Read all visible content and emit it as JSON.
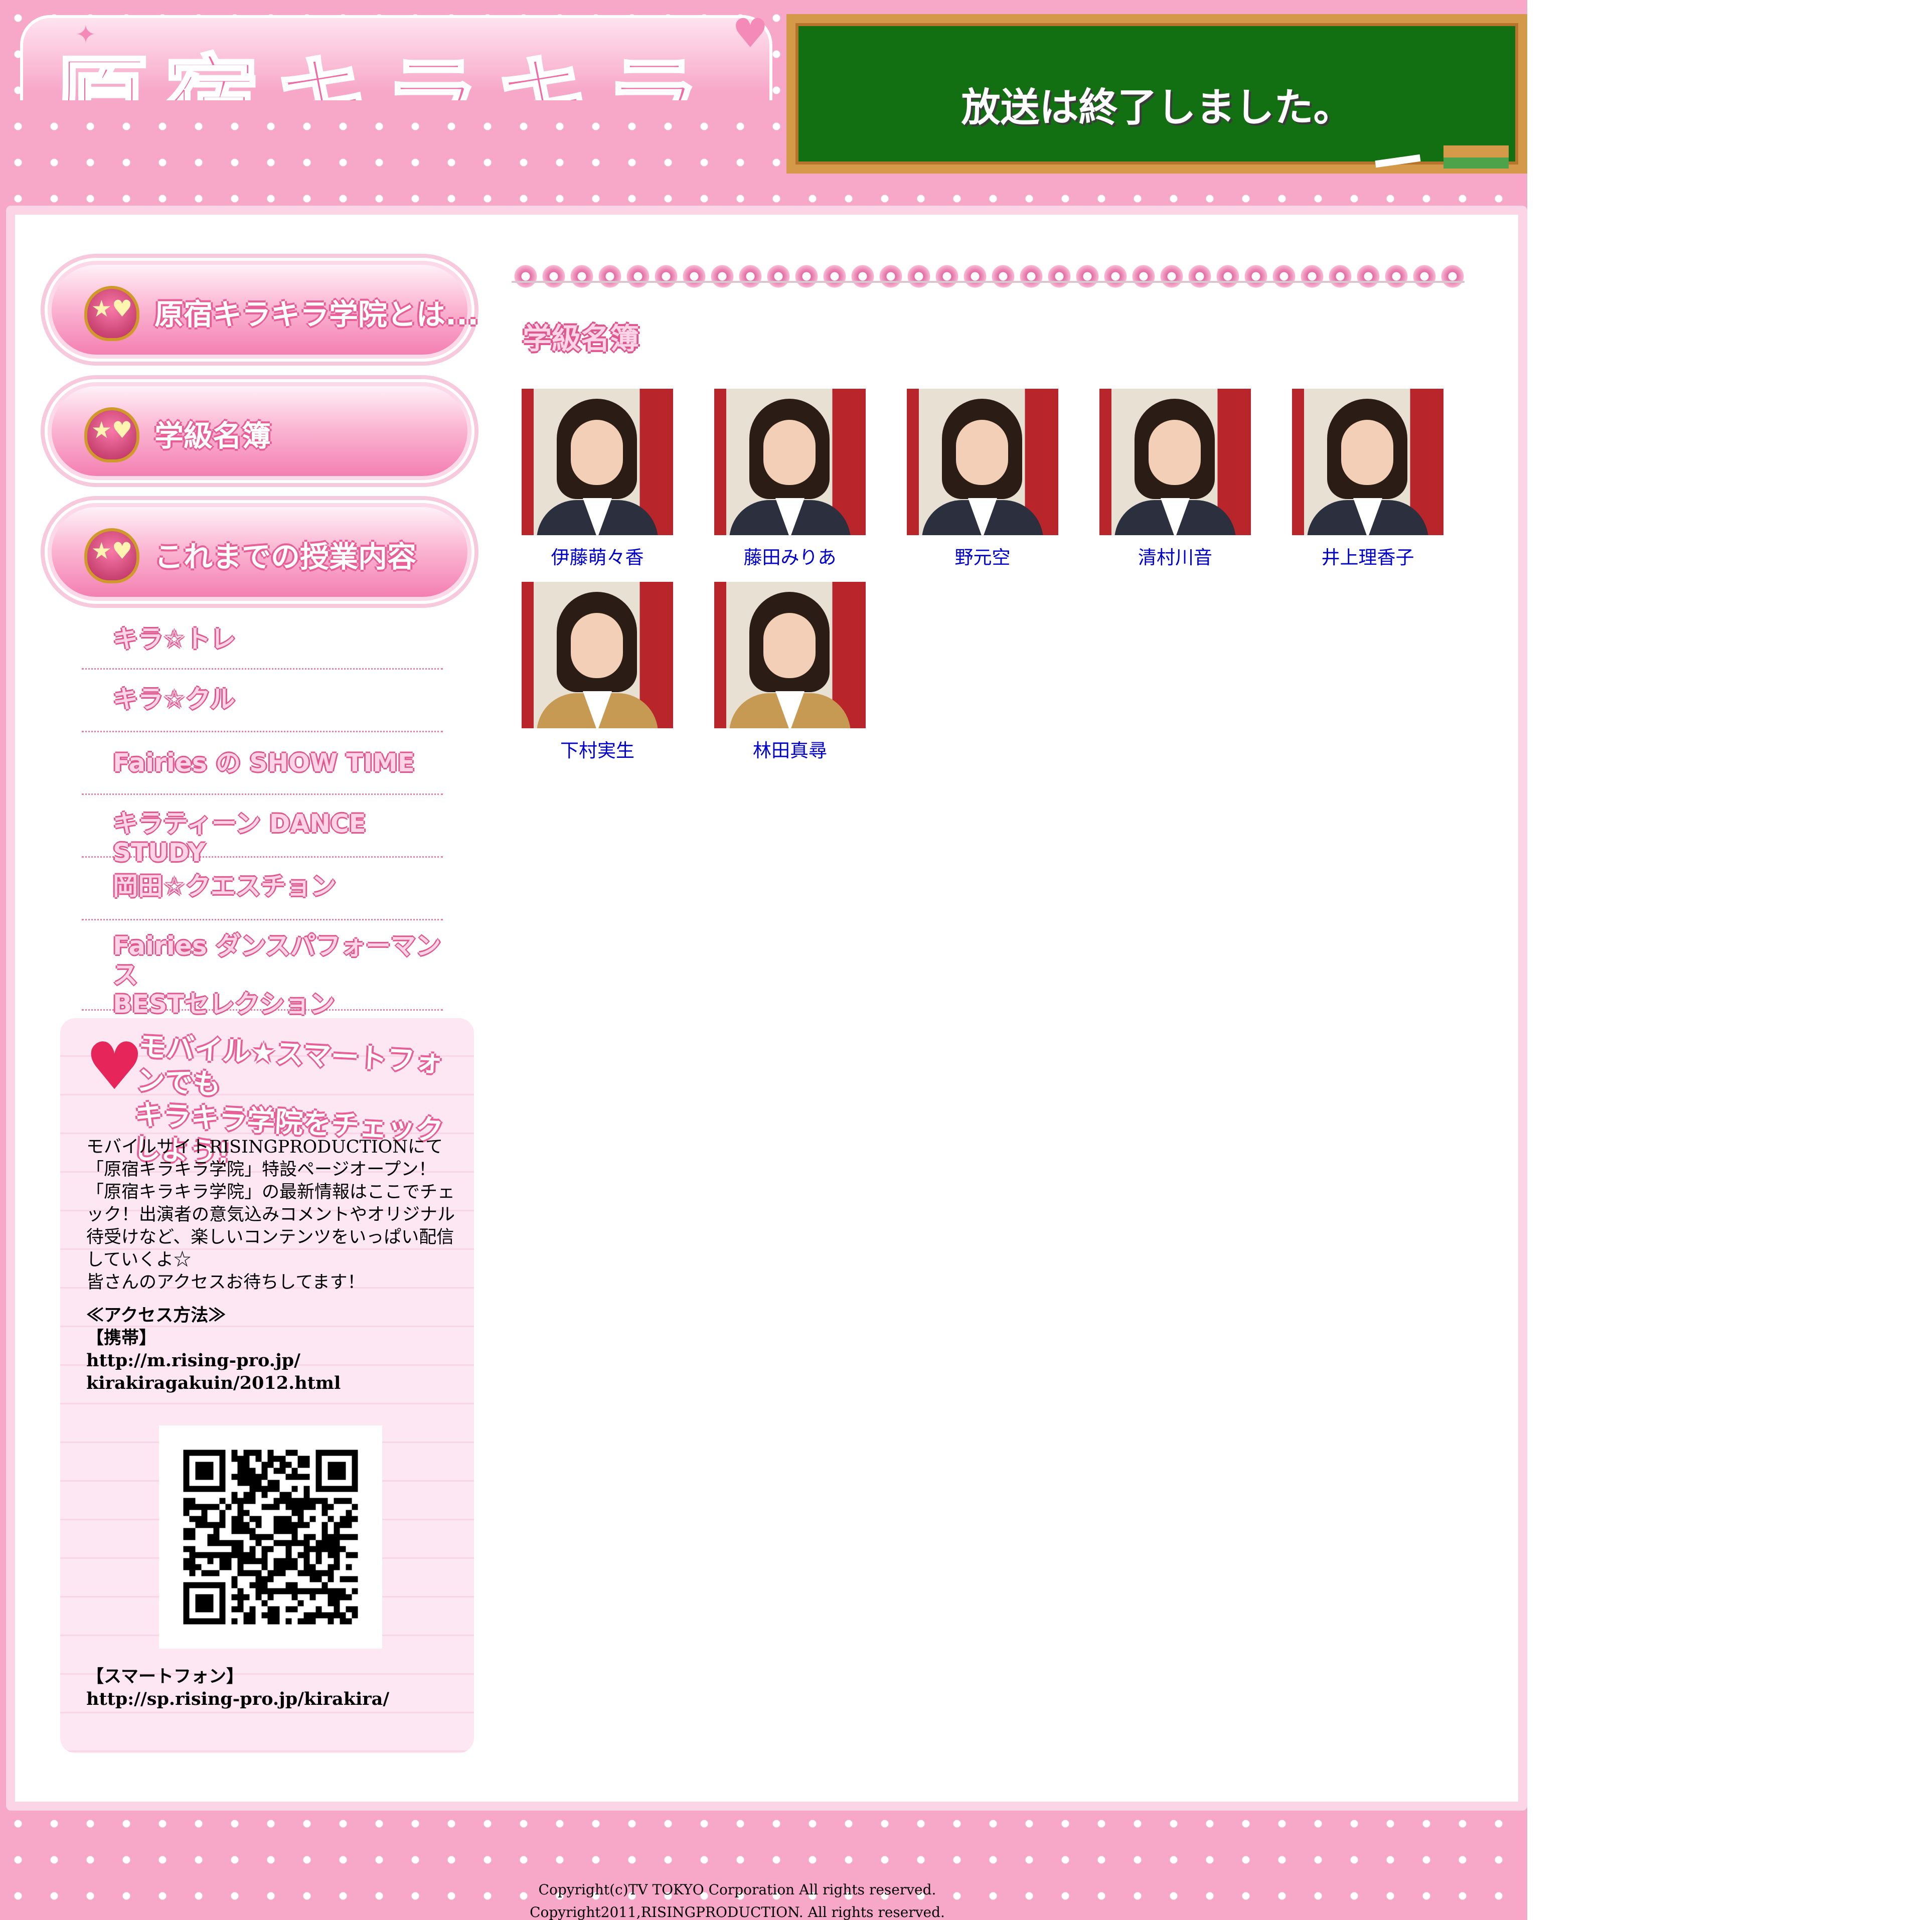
{
  "header": {
    "logo_text": "原宿キラキラ学院",
    "board_message": "放送は終了しました。"
  },
  "sidebar": {
    "nav": [
      {
        "label": "原宿キラキラ学院とは..."
      },
      {
        "label": "学級名簿"
      },
      {
        "label": "これまでの授業内容"
      }
    ],
    "sub_items": [
      {
        "label": "キラ☆トレ"
      },
      {
        "label": "キラ☆クル"
      },
      {
        "label": "Fairies の SHOW TIME"
      },
      {
        "label": "キラティーン DANCE STUDY"
      },
      {
        "label": "岡田☆クエスチョン"
      },
      {
        "label": "Fairies ダンスパフォーマンス\nBESTセレクション"
      }
    ],
    "mobile": {
      "heading": "モバイル★スマートフォンでも\nキラキラ学院をチェックしよう!",
      "description": "モバイルサイトRISINGPRODUCTIONにて\n「原宿キラキラ学院」特設ページオープン！\n「原宿キラキラ学院」の最新情報はここでチェック！出演者の意気込みコメントやオリジナル待受けなど、楽しいコンテンツをいっぱい配信していくよ☆\n皆さんのアクセスお待ちしてます！",
      "access_title": "≪アクセス方法≫",
      "mobile_label": "【携帯】",
      "mobile_url": "http://m.rising-pro.jp/\nkirakiragakuin/2012.html",
      "smartphone_label": "【スマートフォン】",
      "smartphone_url": "http://sp.rising-pro.jp/kirakira/"
    }
  },
  "roster": {
    "title": "学級名簿",
    "members": [
      {
        "name": "伊藤萌々香",
        "blazer": "dark"
      },
      {
        "name": "藤田みりあ",
        "blazer": "dark"
      },
      {
        "name": "野元空",
        "blazer": "dark"
      },
      {
        "name": "清村川音",
        "blazer": "dark"
      },
      {
        "name": "井上理香子",
        "blazer": "dark"
      },
      {
        "name": "下村実生",
        "blazer": "tan"
      },
      {
        "name": "林田真尋",
        "blazer": "tan"
      }
    ]
  },
  "footer": {
    "line1": "Copyright(c)TV TOKYO Corporation All rights reserved.",
    "line2": "Copyright2011,RISINGPRODUCTION. All rights reserved."
  },
  "colors": {
    "background_pink": "#f7a7c8",
    "link_blue": "#0000cc",
    "board_green": "#137012"
  }
}
